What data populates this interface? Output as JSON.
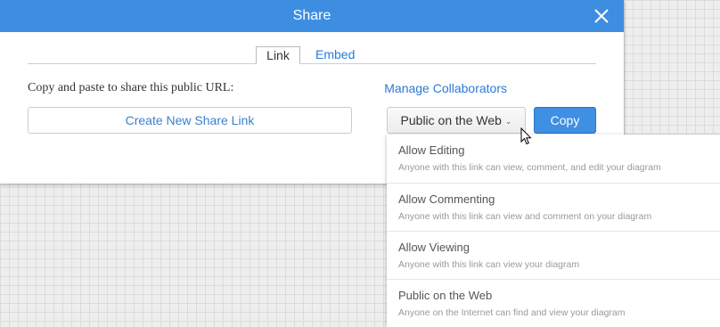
{
  "dialog": {
    "title": "Share",
    "close_icon": "close-icon",
    "tabs": [
      {
        "label": "Link",
        "active": true
      },
      {
        "label": "Embed",
        "active": false
      }
    ],
    "copy_label": "Copy and paste to share this public URL:",
    "manage_link": "Manage Collaborators",
    "create_button": "Create New Share Link",
    "visibility_button": "Public on the Web",
    "copy_button": "Copy"
  },
  "dropdown": {
    "items": [
      {
        "label": "Allow Editing",
        "description": "Anyone with this link can view, comment, and edit your diagram"
      },
      {
        "label": "Allow Commenting",
        "description": "Anyone with this link can view and comment on your diagram"
      },
      {
        "label": "Allow Viewing",
        "description": "Anyone with this link can view your diagram"
      },
      {
        "label": "Public on the Web",
        "description": "Anyone on the Internet can find and view your diagram"
      }
    ]
  },
  "colors": {
    "titlebar": "#3d8ee0",
    "link": "#2a7ad6",
    "primary_button": "#3f8fe2"
  }
}
